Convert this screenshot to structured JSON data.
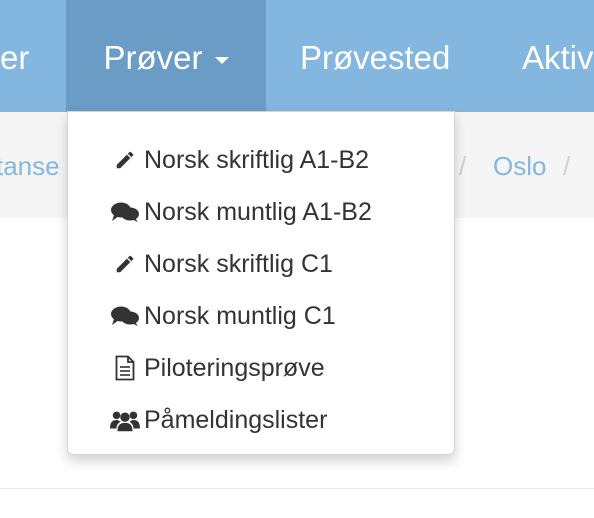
{
  "navbar": {
    "items": [
      {
        "label": "er"
      },
      {
        "label": "Prøver"
      },
      {
        "label": "Prøvested"
      },
      {
        "label": "Aktiv"
      }
    ]
  },
  "breadcrumb": {
    "left_fragment": "tanse",
    "separator": "/",
    "current": "Oslo"
  },
  "dropdown": {
    "items": [
      {
        "label": "Norsk skriftlig A1-B2",
        "icon": "pencil-icon"
      },
      {
        "label": "Norsk muntlig A1-B2",
        "icon": "comments-icon"
      },
      {
        "label": "Norsk skriftlig C1",
        "icon": "pencil-icon"
      },
      {
        "label": "Norsk muntlig C1",
        "icon": "comments-icon"
      },
      {
        "label": "Piloteringsprøve",
        "icon": "document-icon"
      },
      {
        "label": "Påmeldingslister",
        "icon": "users-icon"
      }
    ]
  },
  "colors": {
    "navbar": "#84b7e0",
    "navbar_active": "#6b9cc6",
    "link": "#84b7e0",
    "breadcrumb_bg": "#f5f5f5",
    "menu_text": "#333333"
  }
}
